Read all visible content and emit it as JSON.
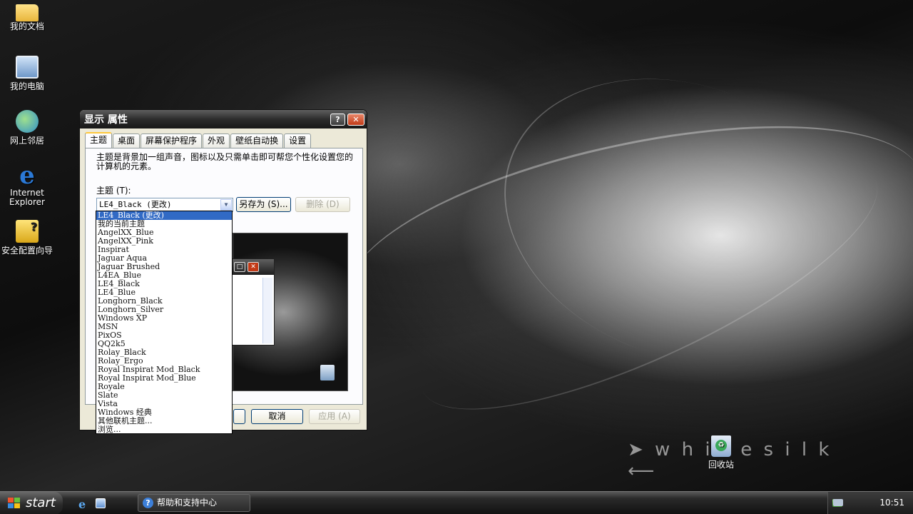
{
  "desktop": {
    "icons": [
      {
        "label": "我的文档",
        "icon": "my-documents-icon"
      },
      {
        "label": "我的电脑",
        "icon": "my-computer-icon"
      },
      {
        "label": "网上邻居",
        "icon": "network-places-icon"
      },
      {
        "label": "Internet Explorer",
        "icon": "internet-explorer-icon"
      },
      {
        "label": "安全配置向导",
        "icon": "security-wizard-icon"
      }
    ],
    "recycle_bin_label": "回收站"
  },
  "window": {
    "title": "显示 属性",
    "help_button": "?",
    "close_button": "✕",
    "tabs": [
      "主题",
      "桌面",
      "屏幕保护程序",
      "外观",
      "壁纸自动换",
      "设置"
    ],
    "description": "主题是背景加一组声音，图标以及只需单击即可帮您个性化设置您的计算机的元素。",
    "theme_label": "主题 (T):",
    "theme_value": "LE4_Black (更改)",
    "save_as_button": "另存为 (S)...",
    "delete_button": "删除 (D)",
    "cancel_button": "取消",
    "apply_button": "应用 (A)"
  },
  "dropdown": {
    "selected_index": 0,
    "items": [
      "LE4_Black (更改)",
      "我的当前主题",
      "AngelXX_Blue",
      "AngelXX_Pink",
      "Inspirat",
      "Jaguar Aqua",
      "Jaguar Brushed",
      "L4EA_Blue",
      "LE4_Black",
      "LE4_Blue",
      "Longhorn_Black",
      "Longhorn_Silver",
      "Windows XP",
      "MSN",
      "PixOS",
      "QQ2k5",
      "Rolay_Black",
      "Rolay_Ergo",
      "Royal Inspirat Mod_Black",
      "Royal Inspirat Mod_Blue",
      "Royale",
      "Slate",
      "Vista",
      "Windows 经典",
      "其他联机主题...",
      "浏览..."
    ]
  },
  "taskbar": {
    "start_label": "start",
    "task_item_label": "帮助和支持中心",
    "clock": "10:51"
  }
}
